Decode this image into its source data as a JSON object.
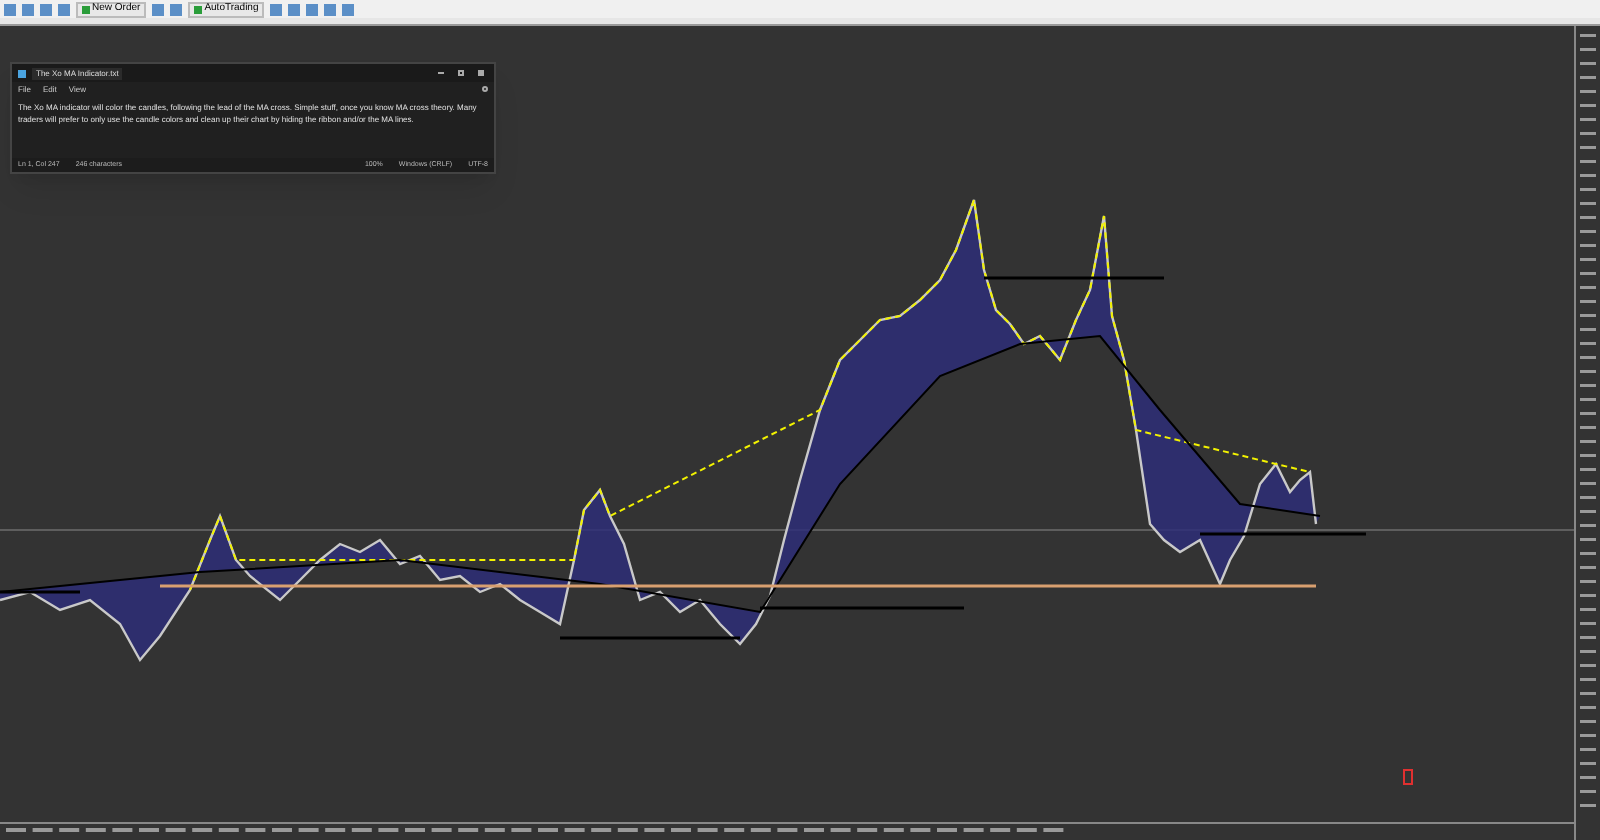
{
  "toolbar": {
    "buttons": [
      {
        "kind": "icon"
      },
      {
        "kind": "icon"
      },
      {
        "kind": "icon"
      },
      {
        "kind": "icon"
      },
      {
        "kind": "text",
        "label": "New Order"
      },
      {
        "kind": "icon"
      },
      {
        "kind": "icon"
      },
      {
        "kind": "text",
        "label": "AutoTrading"
      },
      {
        "kind": "icon"
      },
      {
        "kind": "icon"
      },
      {
        "kind": "icon"
      },
      {
        "kind": "icon"
      },
      {
        "kind": "icon"
      }
    ]
  },
  "notepad": {
    "tab_title": "The Xo MA Indicator.txt",
    "menu": [
      "File",
      "Edit",
      "View"
    ],
    "body": "The Xo MA indicator will color the candles, following the lead of the MA cross. Simple stuff, once you know MA cross theory. Many traders will prefer to only use the candle colors and clean up their chart by hiding the ribbon and/or the MA lines.",
    "status_bar": [
      "Ln 1, Col 247",
      "246 characters",
      "100%",
      "Windows (CRLF)",
      "UTF-8"
    ]
  }
}
